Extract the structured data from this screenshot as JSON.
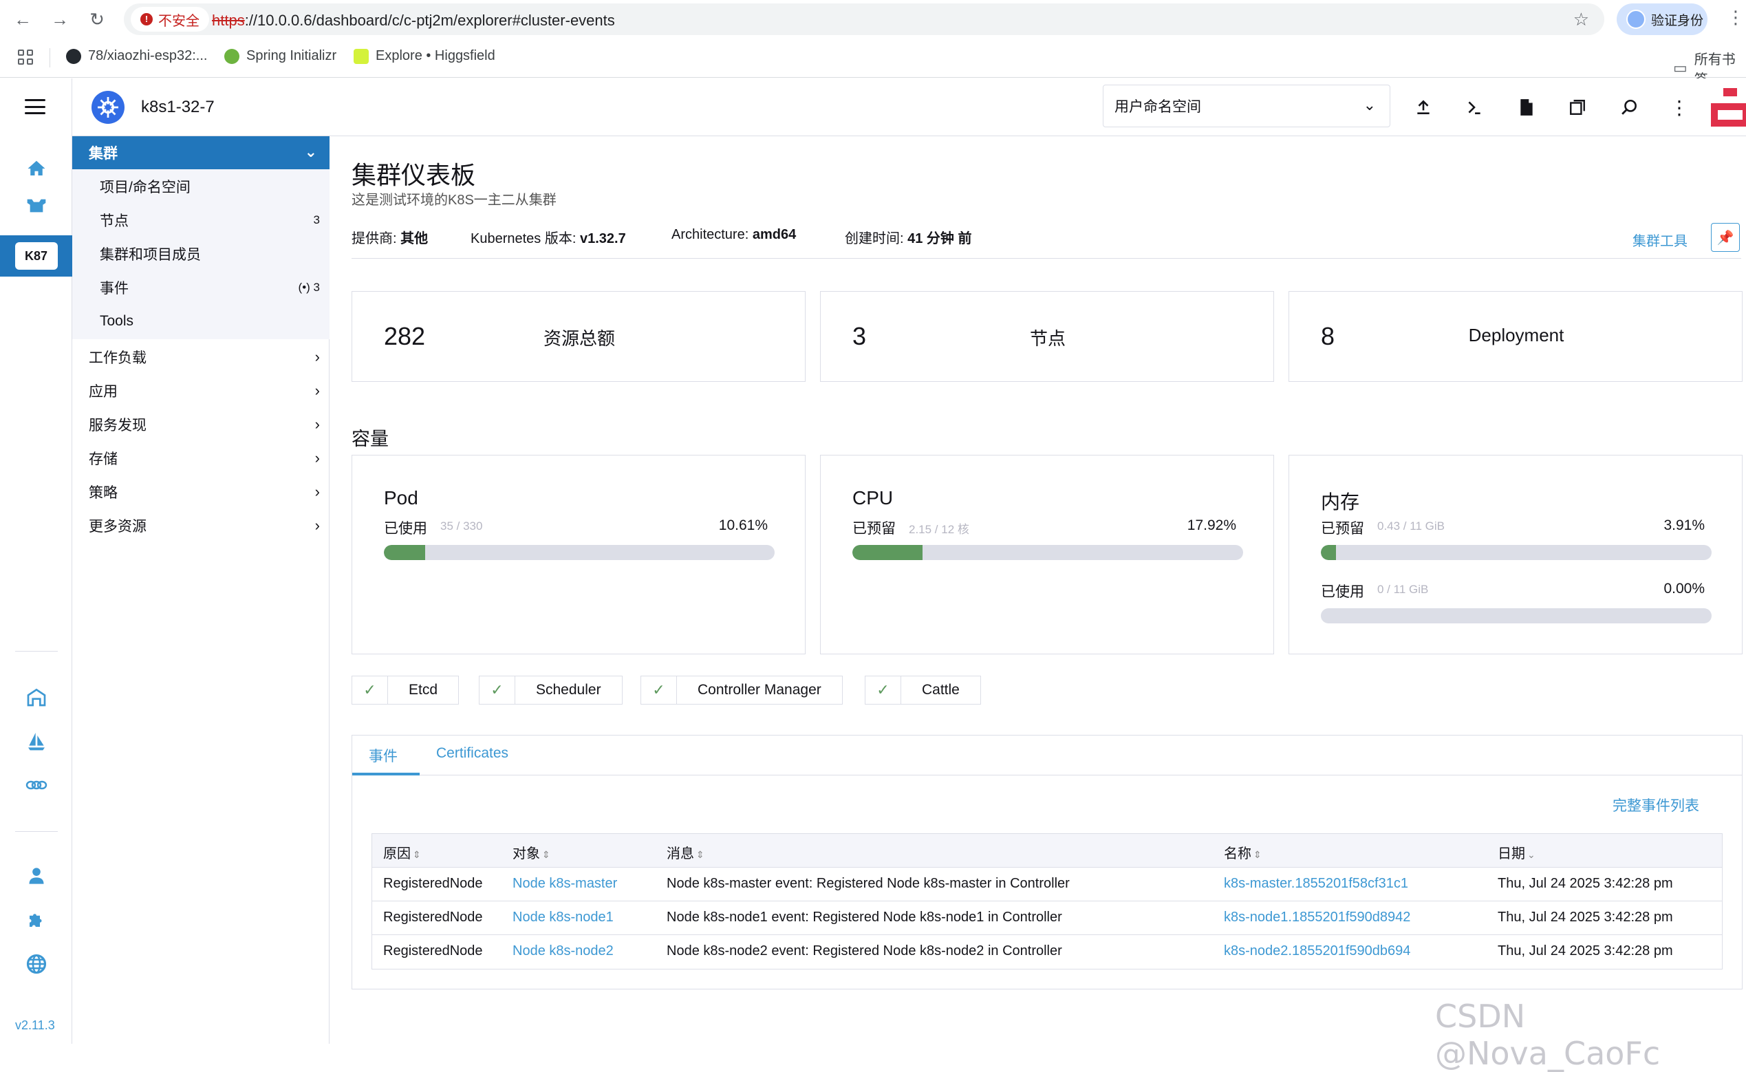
{
  "browser": {
    "back_icon": "arrow-left-icon",
    "forward_icon": "arrow-right-icon",
    "reload_icon": "reload-icon",
    "insecure_label": "不安全",
    "url_scheme": "https",
    "url_rest": "://10.0.0.6/dashboard/c/c-ptj2m/explorer#cluster-events",
    "verify_label": "验证身份",
    "bookmarks": [
      {
        "label": "78/xiaozhi-esp32:...",
        "icon": "github-icon"
      },
      {
        "label": "Spring Initializr",
        "icon": "spring-icon"
      },
      {
        "label": "Explore • Higgsfield",
        "icon": "higgsfield-icon"
      }
    ],
    "all_bookmarks": "所有书签"
  },
  "header": {
    "cluster_name": "k8s1-32-7",
    "namespace_select": "用户命名空间"
  },
  "sidenav": {
    "cluster_badge": "K87",
    "version": "v2.11.3"
  },
  "menu": {
    "group": "集群",
    "subitems": [
      {
        "label": "项目/命名空间",
        "count": ""
      },
      {
        "label": "节点",
        "count": "3"
      },
      {
        "label": "集群和项目成员",
        "count": ""
      },
      {
        "label": "事件",
        "count": "(•) 3"
      },
      {
        "label": "Tools",
        "count": ""
      }
    ],
    "items": [
      "工作负载",
      "应用",
      "服务发现",
      "存储",
      "策略",
      "更多资源"
    ]
  },
  "main": {
    "title": "集群仪表板",
    "subtitle": "这是测试环境的K8S一主二从集群",
    "meta": {
      "provider_label": "提供商:",
      "provider": "其他",
      "k8s_label": "Kubernetes 版本:",
      "k8s": "v1.32.7",
      "arch_label": "Architecture:",
      "arch": "amd64",
      "created_label": "创建时间:",
      "created": "41 分钟 前"
    },
    "tools_link": "集群工具",
    "counts": [
      {
        "num": "282",
        "label": "资源总额"
      },
      {
        "num": "3",
        "label": "节点"
      },
      {
        "num": "8",
        "label": "Deployment"
      }
    ],
    "capacity_title": "容量",
    "capacity": [
      {
        "title": "Pod",
        "lines": [
          {
            "label": "已使用",
            "value": "35 / 330",
            "pct": "10.61%",
            "fraction": 0.1061
          }
        ]
      },
      {
        "title": "CPU",
        "lines": [
          {
            "label": "已预留",
            "value": "2.15 / 12 核",
            "pct": "17.92%",
            "fraction": 0.1792
          }
        ]
      },
      {
        "title": "内存",
        "lines": [
          {
            "label": "已预留",
            "value": "0.43 / 11 GiB",
            "pct": "3.91%",
            "fraction": 0.0391
          },
          {
            "label": "已使用",
            "value": "0 / 11 GiB",
            "pct": "0.00%",
            "fraction": 0.0
          }
        ]
      }
    ],
    "components": [
      "Etcd",
      "Scheduler",
      "Controller Manager",
      "Cattle"
    ],
    "tabs": [
      "事件",
      "Certificates"
    ],
    "full_events_link": "完整事件列表",
    "table": {
      "headers": [
        "原因",
        "对象",
        "消息",
        "名称",
        "日期"
      ],
      "rows": [
        [
          "RegisteredNode",
          "Node k8s-master",
          "Node k8s-master event: Registered Node k8s-master in Controller",
          "k8s-master.1855201f58cf31c1",
          "Thu, Jul 24 2025  3:42:28 pm"
        ],
        [
          "RegisteredNode",
          "Node k8s-node1",
          "Node k8s-node1 event: Registered Node k8s-node1 in Controller",
          "k8s-node1.1855201f590d8942",
          "Thu, Jul 24 2025  3:42:28 pm"
        ],
        [
          "RegisteredNode",
          "Node k8s-node2",
          "Node k8s-node2 event: Registered Node k8s-node2 in Controller",
          "k8s-node2.1855201f590db694",
          "Thu, Jul 24 2025  3:42:28 pm"
        ]
      ]
    }
  },
  "watermark": "CSDN @Nova_CaoFc",
  "colors": {
    "accent": "#3d98d3",
    "active_bg": "#2176bb",
    "success": "#5d995d"
  }
}
